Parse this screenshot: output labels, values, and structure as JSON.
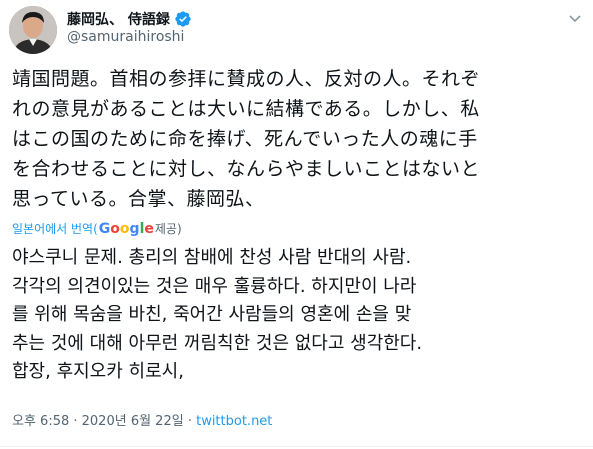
{
  "author": {
    "display_name": "藤岡弘、 侍語録",
    "handle": "@samuraihiroshi",
    "verified": true
  },
  "tweet": {
    "japanese_lines": [
      "靖国問題。首相の参拝に賛成の人、反対の人。それぞ",
      "れの意見があることは大いに結構である。しかし、私",
      "はこの国のために命を捧げ、死んでいった人の魂に手",
      "を合わせることに対し、なんらやましいことはないと",
      "思っている。合掌、藤岡弘、"
    ],
    "translation": {
      "prefix": "일본어에서 번역(",
      "google_letters": [
        {
          "ch": "G",
          "color": "#4285F4"
        },
        {
          "ch": "o",
          "color": "#EA4335"
        },
        {
          "ch": "o",
          "color": "#FBBC05"
        },
        {
          "ch": "g",
          "color": "#4285F4"
        },
        {
          "ch": "l",
          "color": "#34A853"
        },
        {
          "ch": "e",
          "color": "#EA4335"
        }
      ],
      "suffix": " 제공)"
    },
    "korean_lines": [
      "야스쿠니 문제. 총리의 참배에 찬성 사람 반대의 사람.",
      "각각의 의견이있는 것은 매우 훌륭하다. 하지만이 나라",
      "를 위해 목숨을 바친, 죽어간 사람들의 영혼에 손을 맞",
      "추는 것에 대해 아무런 꺼림칙한 것은 없다고 생각한다.",
      "합장, 후지오카 히로시,"
    ],
    "meta": {
      "time_date": "오후 6:58 · 2020년 6월 22일 · ",
      "source": "twittbot.net"
    }
  },
  "colors": {
    "accent": "#1d9bf0",
    "text": "#0f1419",
    "muted": "#536471"
  },
  "icons": {
    "verified": "verified-badge-icon",
    "menu": "chevron-down-icon"
  }
}
